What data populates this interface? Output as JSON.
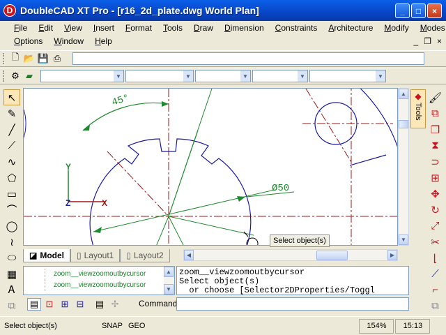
{
  "window": {
    "title": "DoubleCAD XT Pro - [r16_2d_plate.dwg World Plan]",
    "icon": "D"
  },
  "menu": {
    "row1": [
      "File",
      "Edit",
      "View",
      "Insert",
      "Format",
      "Tools",
      "Draw",
      "Dimension",
      "Constraints",
      "Architecture",
      "Modify",
      "Modes"
    ],
    "row2": [
      "Options",
      "Window",
      "Help"
    ]
  },
  "mdi": {
    "min": "_",
    "restore": "❐",
    "close": "×"
  },
  "drawing": {
    "angle_label": "45°",
    "diameter_label": "Ø50",
    "axis_y": "Y",
    "axis_x": "X",
    "axis_z": "Z"
  },
  "tooltip": "Select object(s)",
  "tabs": [
    {
      "label": "Model"
    },
    {
      "label": "Layout1"
    },
    {
      "label": "Layout2"
    }
  ],
  "command_list": [
    "zoom__viewzoomoutbycursor",
    "zoom__viewzoomoutbycursor"
  ],
  "command_output": "zoom__viewzoomoutbycursor\nSelect object(s)\n  or choose [Selector2DProperties/Toggl",
  "command_label": "Command:",
  "side_tab": "Tools",
  "status": {
    "message": "Select object(s)",
    "snap": "SNAP",
    "geo": "GEO",
    "zoom": "154%",
    "time": "15:13"
  },
  "colors": {
    "drawing_green": "#1E8A2E",
    "center_red": "#A01818",
    "shape_blue": "#1A1AA0"
  }
}
